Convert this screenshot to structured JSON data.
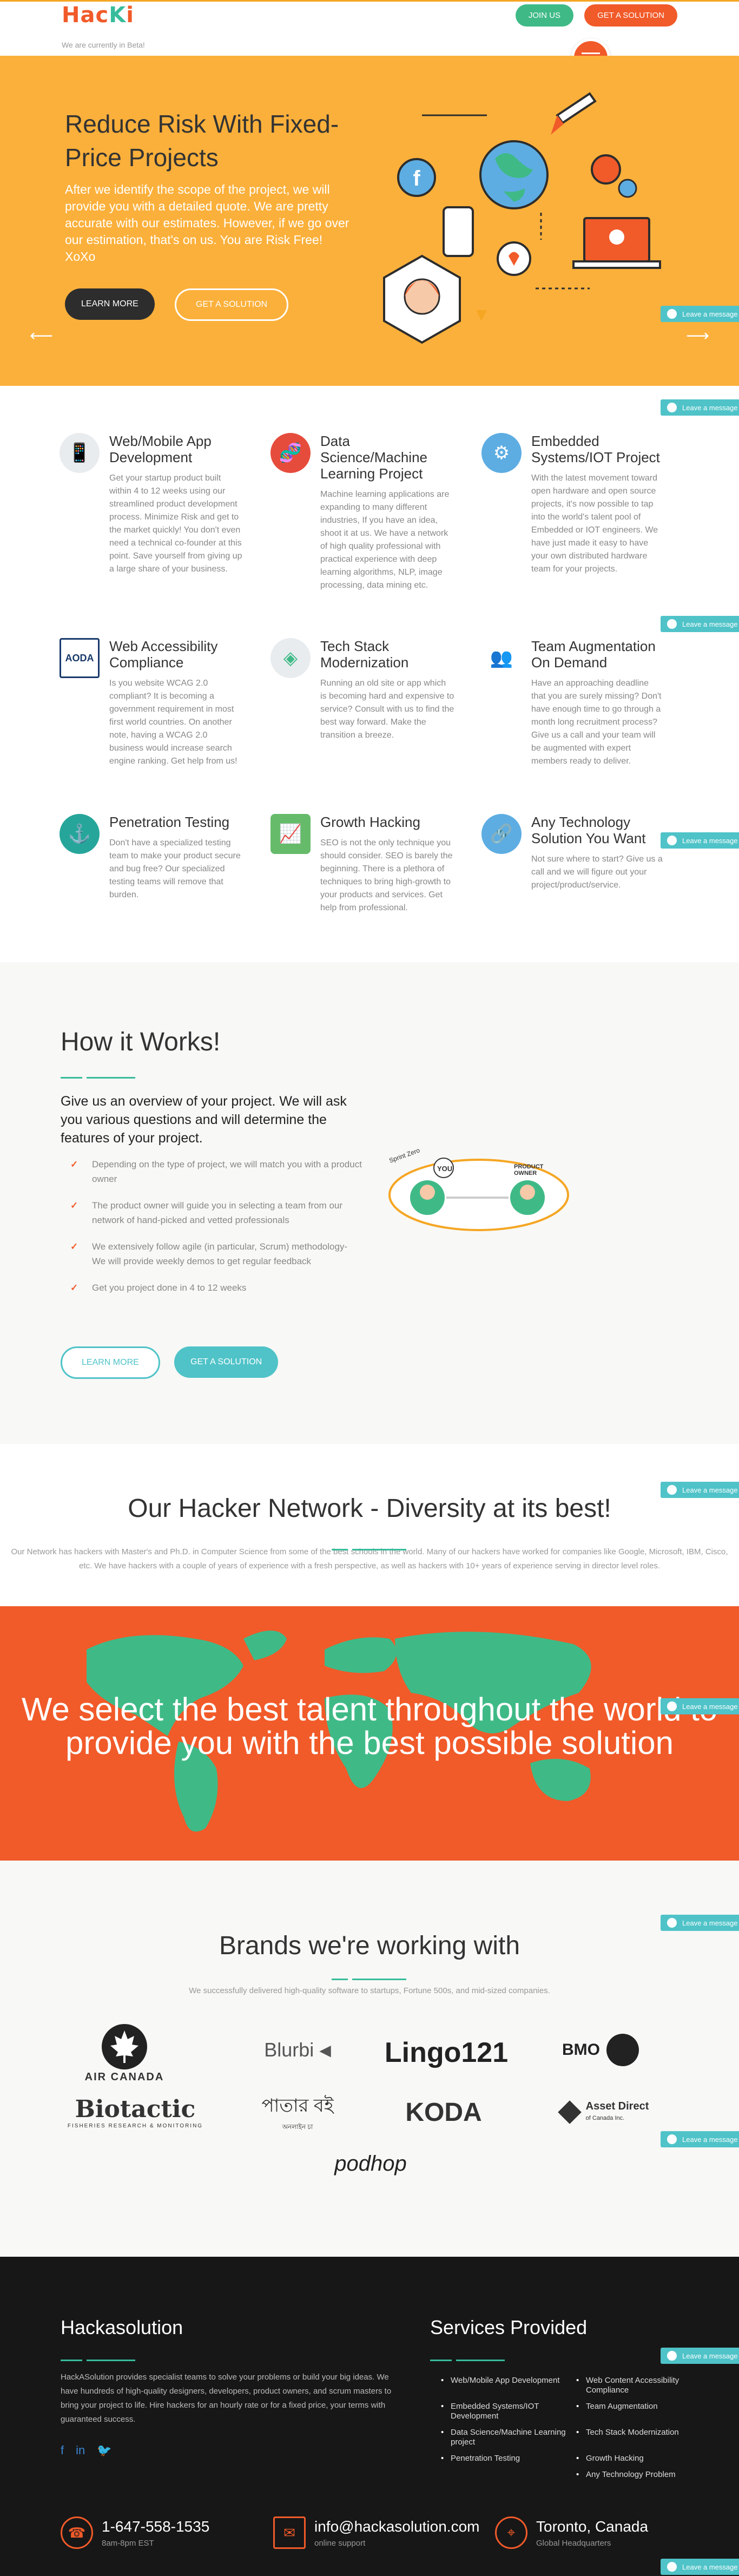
{
  "brand": {
    "logo_part1": "Hac",
    "logo_part2": "K",
    "logo_part3": "i",
    "beta": "We are currently in Beta!"
  },
  "nav": {
    "join": "JOIN US",
    "solution": "GET A SOLUTION"
  },
  "hero": {
    "title": "Reduce Risk With Fixed-Price Projects",
    "text": "After we identify the scope of the project, we will provide you with a detailed quote. We are pretty accurate with our estimates. However, if we go over our estimation, that's on us. You are Risk Free! XoXo",
    "learn": "LEARN MORE",
    "solution": "GET A SOLUTION"
  },
  "leave_message": "Leave a message",
  "services": [
    {
      "title": "Web/Mobile App Development",
      "text": "Get your startup product built within 4 to 12 weeks using our streamlined product development process. Minimize Risk and get to the market quickly! You don't even need a technical co-founder at this point. Save yourself from giving up a large share of your business.",
      "icon": "mobile-icon",
      "color": "#e8ecef"
    },
    {
      "title": "Data Science/Machine Learning Project",
      "text": "Machine learning applications are expanding to many different industries, If you have an idea, shoot it at us. We have a network of high quality professional with practical experience with deep learning algorithms, NLP, image processing, data mining etc.",
      "icon": "dna-icon",
      "color": "#e64c3c"
    },
    {
      "title": "Embedded Systems/IOT Project",
      "text": "With the latest movement toward open hardware and open source projects, it's now possible to tap into the world's talent pool of Embedded or IOT engineers. We have just made it easy to have your own distributed hardware team for your projects.",
      "icon": "chip-icon",
      "color": "#5dade2"
    },
    {
      "title": "Web Accessibility Compliance",
      "text": "Is you website WCAG 2.0 compliant? It is becoming a government requirement in most first world countries. On another note, having a WCAG 2.0 business would increase search engine ranking. Get help from us!",
      "icon": "aoda-icon",
      "color": "#ffffff"
    },
    {
      "title": "Tech Stack Modernization",
      "text": "Running an old site or app which is becoming hard and expensive to service? Consult with us to find the best way forward. Make the transition a breeze.",
      "icon": "layers-icon",
      "color": "#e8ecef"
    },
    {
      "title": "Team Augmentation On Demand",
      "text": "Have an approaching deadline that you are surely missing? Don't have enough time to go through a month long recruitment process? Give us a call and your team will be augmented with expert members ready to deliver.",
      "icon": "team-icon",
      "color": "#ffffff"
    },
    {
      "title": "Penetration Testing",
      "text": "Don't have a specialized testing team to make your product secure and bug free? Our specialized testing teams will remove that burden.",
      "icon": "anchor-icon",
      "color": "#26a69a"
    },
    {
      "title": "Growth Hacking",
      "text": "SEO is not the only technique you should consider. SEO is barely the beginning. There is a plethora of techniques to bring high-growth to your products and services. Get help from professional.",
      "icon": "growth-icon",
      "color": "#66bb6a"
    },
    {
      "title": "Any Technology Solution You Want",
      "text": "Not sure where to start? Give us a call and we will figure out your project/product/service.",
      "icon": "link-icon",
      "color": "#5dade2"
    }
  ],
  "how": {
    "title": "How it Works!",
    "lead": "Give us an overview of your project. We will ask you various questions and will determine the features of your project.",
    "steps": [
      "Depending on the type of project, we will match you with a product owner",
      "The product owner will guide you in selecting a team from our network of hand-picked and vetted professionals",
      "We extensively follow agile (in particular, Scrum) methodology- We will provide weekly demos to get regular feedback",
      "Get you project done in 4 to 12 weeks"
    ],
    "learn": "LEARN MORE",
    "solution": "GET A SOLUTION",
    "diagram_you": "YOU",
    "diagram_po": "PRODUCT OWNER",
    "diagram_start": "Sprint Zero"
  },
  "network": {
    "title": "Our Hacker Network - Diversity at its best!",
    "text": "Our Network has hackers with Master's and Ph.D. in Computer Science from some of the best schools in the world. Many of our hackers have worked for companies like Google, Microsoft, IBM, Cisco, etc. We have hackers with a couple of years of experience with a fresh perspective, as well as hackers with 10+ years of experience serving in director level roles."
  },
  "talent": {
    "title": "We select the best talent throughout the world to provide you with the best possible solution"
  },
  "brands": {
    "title": "Brands we're working with",
    "sub": "We successfully delivered high-quality software to startups, Fortune 500s, and mid-sized companies.",
    "logos": [
      "AIR CANADA",
      "Blurbi",
      "Lingo121",
      "BMO",
      "Biotactic",
      "পাতার বই",
      "KODA",
      "Asset Direct",
      "podhop"
    ],
    "biotactic_sub": "FISHERIES RESEARCH & MONITORING",
    "asset_sub": "of Canada Inc.",
    "patar_sub": "অনলাইন চা"
  },
  "footer": {
    "about_title": "Hackasolution",
    "about": "HackASolution provides specialist teams to solve your problems or build your big ideas. We have hundreds of high-quality designers, developers, product owners, and scrum masters to bring your project to life. Hire hackers for an hourly rate or for a fixed price, your terms with guaranteed success.",
    "services_title": "Services Provided",
    "services": [
      "Web/Mobile App Development",
      "Web Content Accessibility Compliance",
      "Embedded Systems/IOT Development",
      "Team Augmentation",
      "Data Science/Machine Learning project",
      "Tech Stack Modernization",
      "Penetration Testing",
      "Growth Hacking",
      "",
      "Any Technology Problem"
    ],
    "phone": "1-647-558-1535",
    "phone_sub": "8am-8pm EST",
    "email": "info@hackasolution.com",
    "email_sub": "online support",
    "city": "Toronto, Canada",
    "city_sub": "Global Headquarters"
  }
}
